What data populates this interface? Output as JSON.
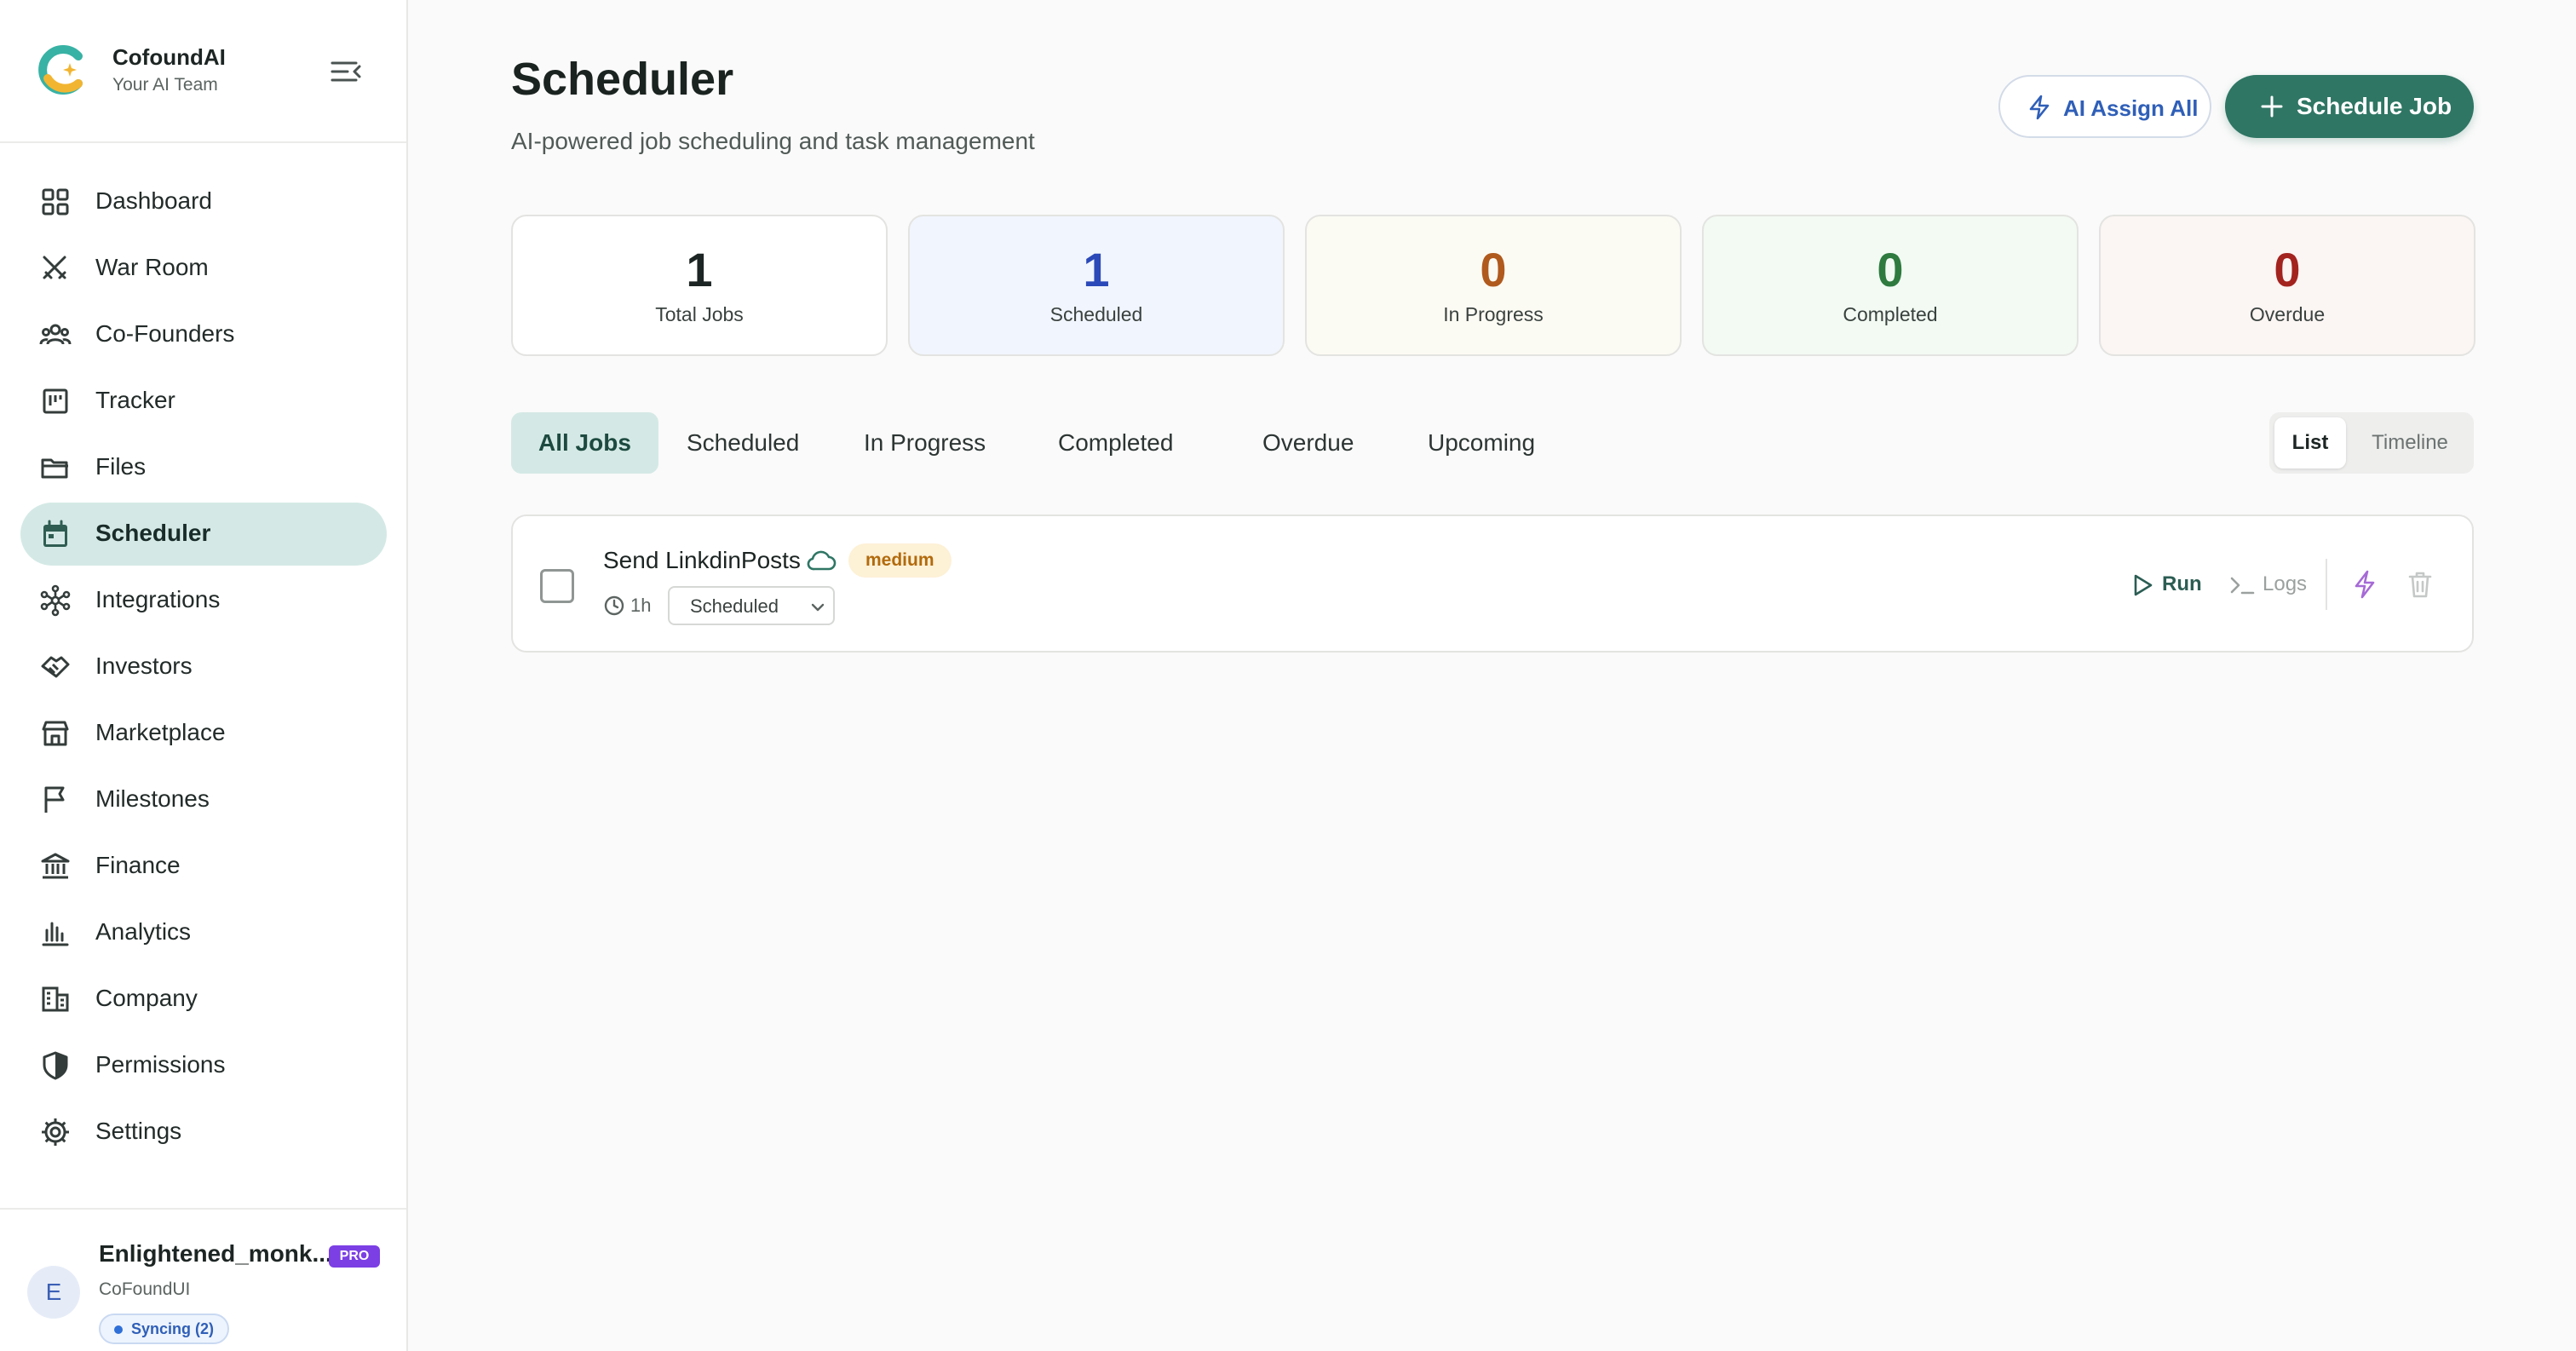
{
  "brand": {
    "name": "CofoundAI",
    "tagline": "Your AI Team"
  },
  "sidebar": {
    "items": [
      {
        "label": "Dashboard",
        "icon": "grid-icon"
      },
      {
        "label": "War Room",
        "icon": "crossed-swords-icon"
      },
      {
        "label": "Co-Founders",
        "icon": "users-icon"
      },
      {
        "label": "Tracker",
        "icon": "kanban-icon"
      },
      {
        "label": "Files",
        "icon": "folder-icon"
      },
      {
        "label": "Scheduler",
        "icon": "calendar-icon",
        "active": true
      },
      {
        "label": "Integrations",
        "icon": "network-icon"
      },
      {
        "label": "Investors",
        "icon": "handshake-icon"
      },
      {
        "label": "Marketplace",
        "icon": "store-icon"
      },
      {
        "label": "Milestones",
        "icon": "flag-icon"
      },
      {
        "label": "Finance",
        "icon": "bank-icon"
      },
      {
        "label": "Analytics",
        "icon": "bar-chart-icon"
      },
      {
        "label": "Company",
        "icon": "building-icon"
      },
      {
        "label": "Permissions",
        "icon": "shield-icon"
      },
      {
        "label": "Settings",
        "icon": "gear-icon"
      }
    ]
  },
  "user": {
    "initial": "E",
    "name": "Enlightened_monk...",
    "badge": "PRO",
    "org": "CoFoundUI",
    "sync": "Syncing (2)"
  },
  "header": {
    "title": "Scheduler",
    "subtitle": "AI-powered job scheduling and task management",
    "ai_assign_label": "AI Assign All",
    "schedule_label": "Schedule Job"
  },
  "stats": [
    {
      "value": "1",
      "label": "Total Jobs",
      "color": "#1c2523",
      "bg": "#ffffff"
    },
    {
      "value": "1",
      "label": "Scheduled",
      "color": "#2b49b8",
      "bg": "#f1f5fd"
    },
    {
      "value": "0",
      "label": "In Progress",
      "color": "#b05a1e",
      "bg": "#fcfbf3"
    },
    {
      "value": "0",
      "label": "Completed",
      "color": "#2e7a3f",
      "bg": "#f2faf3"
    },
    {
      "value": "0",
      "label": "Overdue",
      "color": "#a3231f",
      "bg": "#fbf5f3"
    }
  ],
  "tabs": [
    {
      "label": "All Jobs",
      "active": true
    },
    {
      "label": "Scheduled"
    },
    {
      "label": "In Progress"
    },
    {
      "label": "Completed"
    },
    {
      "label": "Overdue"
    },
    {
      "label": "Upcoming"
    }
  ],
  "view": {
    "list": "List",
    "timeline": "Timeline",
    "selected": "List"
  },
  "jobs": [
    {
      "title": "Send LinkdinPosts",
      "priority": "medium",
      "duration": "1h",
      "status": "Scheduled",
      "run_label": "Run",
      "logs_label": "Logs"
    }
  ]
}
